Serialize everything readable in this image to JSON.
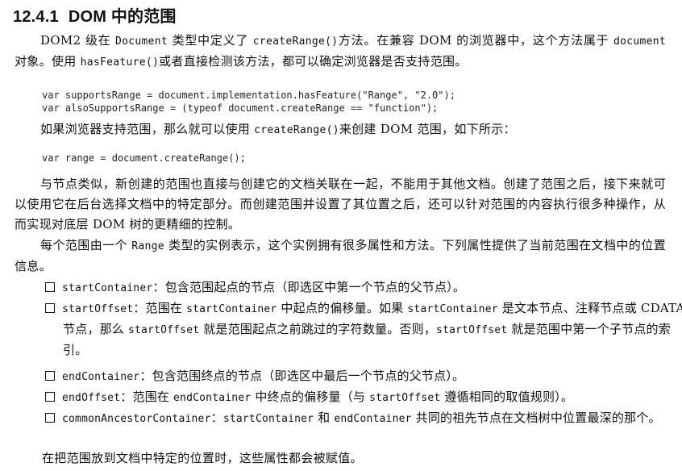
{
  "section": {
    "number": "12.4.1",
    "title": "DOM 中的范围"
  },
  "intro": {
    "p1_a": "DOM2 级在 ",
    "p1_code1": "Document",
    "p1_b": " 类型中定义了 ",
    "p1_code2": "createRange()",
    "p1_c": "方法。在兼容 DOM 的浏览器中，这个方法属于 ",
    "p1_code3": "document",
    "p1_d": " 对象。使用 ",
    "p1_code4": "hasFeature()",
    "p1_e": "或者直接检测该方法，都可以确定浏览器是否支持范围。"
  },
  "code1": {
    "line1": "var supportsRange = document.implementation.hasFeature(\"Range\", \"2.0\");",
    "line2": "var alsoSupportsRange = (typeof document.createRange == \"function\");"
  },
  "p2": {
    "a": "如果浏览器支持范围，那么就可以使用 ",
    "code": "createRange()",
    "b": "来创建 DOM 范围，如下所示："
  },
  "code2": {
    "line1": "var range = document.createRange();"
  },
  "p3": {
    "text": "与节点类似，新创建的范围也直接与创建它的文档关联在一起，不能用于其他文档。创建了范围之后，接下来就可以使用它在后台选择文档中的特定部分。而创建范围并设置了其位置之后，还可以针对范围的内容执行很多种操作，从而实现对底层 DOM 树的更精细的控制。"
  },
  "p4": {
    "a": "每个范围由一个 ",
    "code": "Range",
    "b": " 类型的实例表示，这个实例拥有很多属性和方法。下列属性提供了当前范围在文档中的位置信息。"
  },
  "props": [
    {
      "name": "startContainer",
      "desc": "：包含范围起点的节点（即选区中第一个节点的父节点）。"
    },
    {
      "name": "startOffset",
      "desc_a": "：范围在 ",
      "code_a": "startContainer",
      "desc_b": " 中起点的偏移量。如果 ",
      "code_b": "startContainer",
      "desc_c": " 是文本节点、注释节点或 CDATA 节点，那么 ",
      "code_c": "startOffset",
      "desc_d": " 就是范围起点之前跳过的字符数量。否则，",
      "code_d": "startOffset",
      "desc_e": " 就是范围中第一个子节点的索引。"
    },
    {
      "name": "endContainer",
      "desc": "：包含范围终点的节点（即选区中最后一个节点的父节点）。"
    },
    {
      "name": "endOffset",
      "desc_a": "：范围在 ",
      "code_a": "endContainer",
      "desc_b": " 中终点的偏移量（与 ",
      "code_b": "startOffset",
      "desc_c": " 遵循相同的取值规则）。"
    },
    {
      "name": "commonAncestorContainer",
      "desc_a": "：",
      "code_a": "startContainer",
      "desc_b": " 和 ",
      "code_b": "endContainer",
      "desc_c": " 共同的祖先节点在文档树中位置最深的那个。"
    }
  ],
  "closing": {
    "text": "在把范围放到文档中特定的位置时，这些属性都会被赋值。"
  }
}
